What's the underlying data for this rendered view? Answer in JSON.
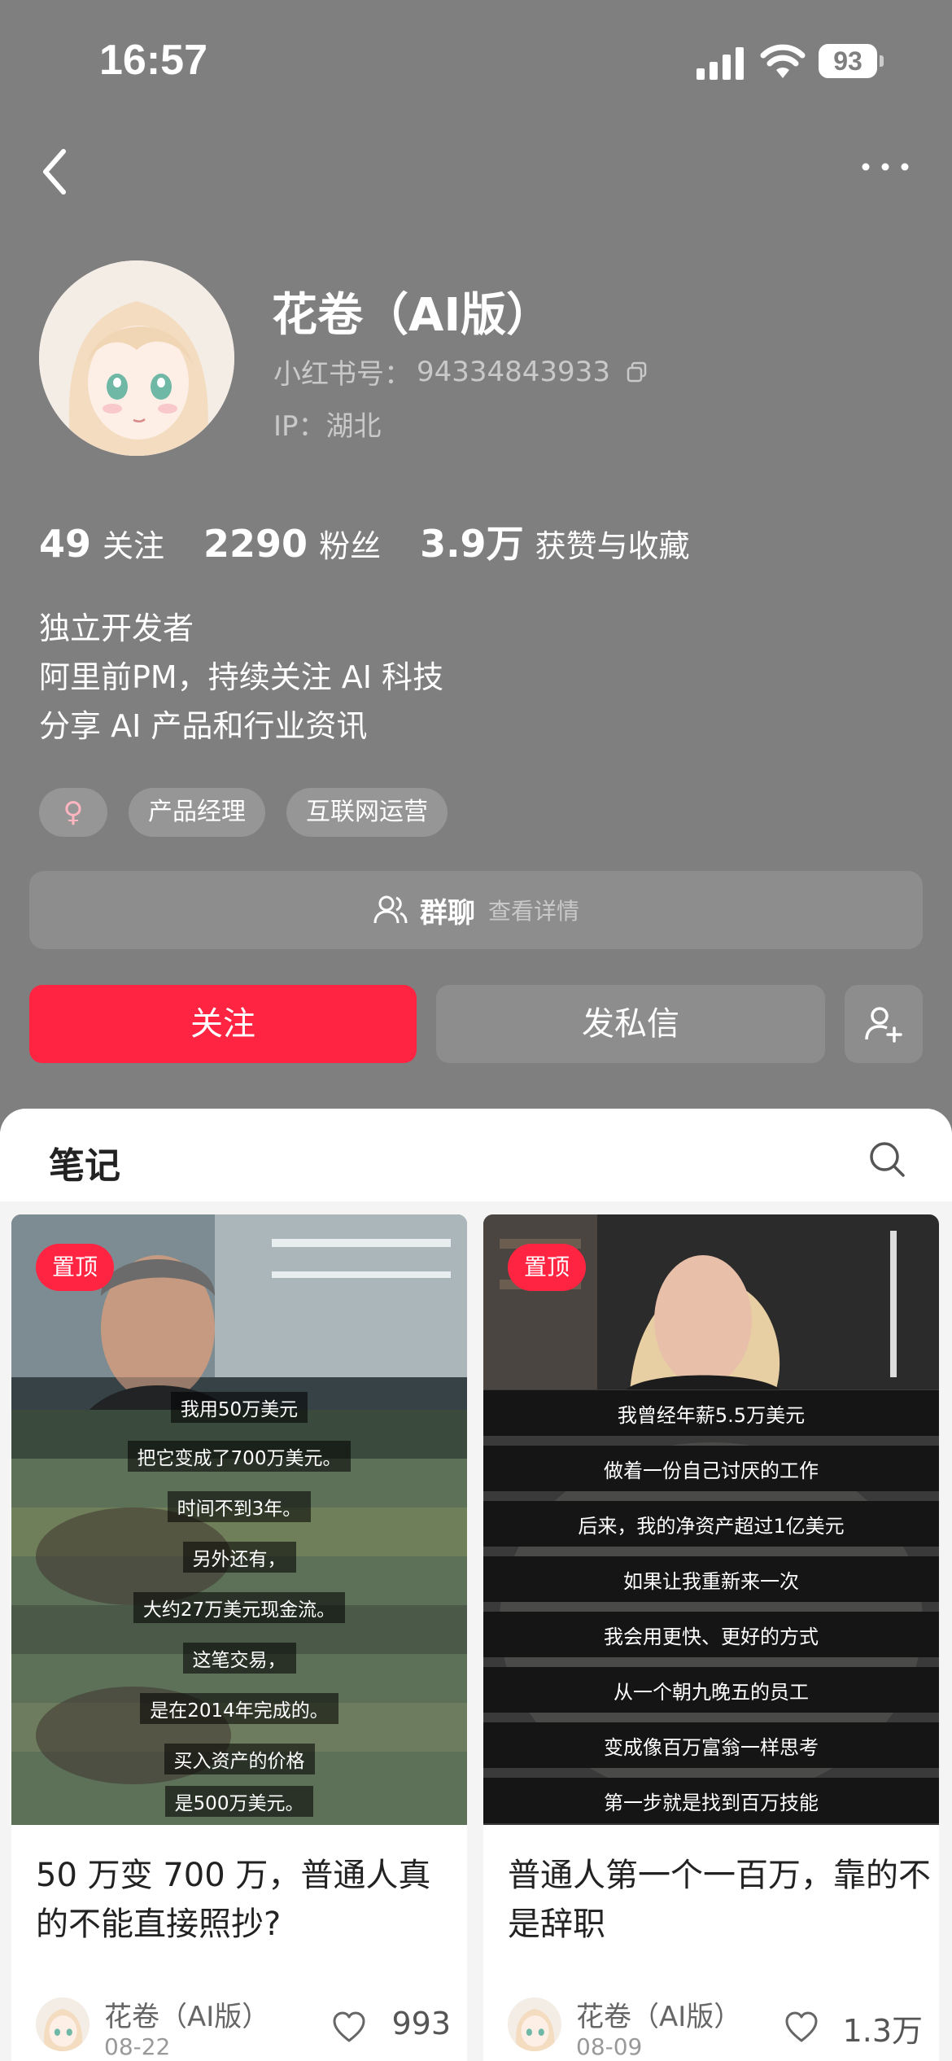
{
  "status_bar": {
    "time": "16:57",
    "battery": "93"
  },
  "profile": {
    "name": "花卷（AI版）",
    "id_label": "小红书号：",
    "id_value": "94334843933",
    "ip": "IP：湖北",
    "stats": [
      {
        "value": "49",
        "label": "关注"
      },
      {
        "value": "2290",
        "label": "粉丝"
      },
      {
        "value": "3.9万",
        "label": "获赞与收藏"
      }
    ],
    "bio": [
      "独立开发者",
      "阿里前PM，持续关注 AI 科技",
      "分享 AI 产品和行业资讯"
    ],
    "gender_symbol": "♀",
    "tags": [
      "产品经理",
      "互联网运营"
    ],
    "group_chat": {
      "title": "群聊",
      "subtitle": "查看详情"
    },
    "follow_label": "关注",
    "message_label": "发私信"
  },
  "notes_section": {
    "title": "笔记",
    "cards": [
      {
        "badge": "置顶",
        "subtitles": [
          "我用50万美元",
          "把它变成了700万美元。",
          "时间不到3年。",
          "另外还有，",
          "大约27万美元现金流。",
          "这笔交易，",
          "是在2014年完成的。",
          "买入资产的价格",
          "是500万美元。"
        ],
        "title": "50 万变 700 万，普通人真的不能直接照抄?",
        "author": "花卷（AI版）",
        "date": "08-22",
        "likes": "993"
      },
      {
        "badge": "置顶",
        "subtitles": [
          "我曾经年薪5.5万美元",
          "做着一份自己讨厌的工作",
          "后来，我的净资产超过1亿美元",
          "如果让我重新来一次",
          "我会用更快、更好的方式",
          "从一个朝九晚五的员工",
          "变成像百万富翁一样思考",
          "第一步就是找到百万技能"
        ],
        "title": "普通人第一个一百万，靠的不是辞职",
        "author": "花卷（AI版）",
        "date": "08-09",
        "likes": "1.3万"
      }
    ]
  },
  "colors": {
    "accent": "#ff2442",
    "overlay_bg": "#7f7f7f"
  }
}
